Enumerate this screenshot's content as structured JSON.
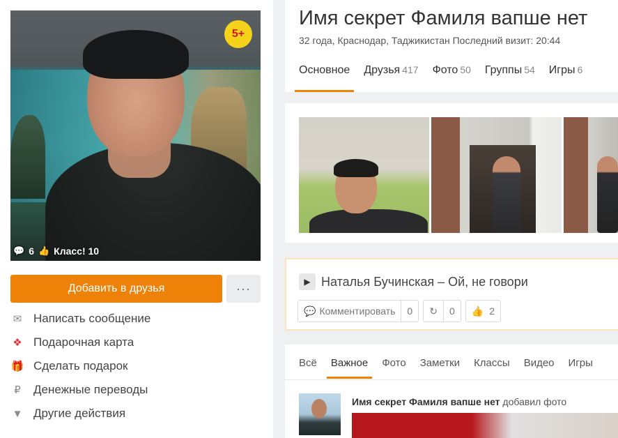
{
  "profile": {
    "badge": "5+",
    "comments_count": "6",
    "class_label": "Класс! 10",
    "add_friend_label": "Добавить в друзья",
    "more_label": "···",
    "actions": [
      {
        "icon": "envelope-icon",
        "label": "Написать сообщение"
      },
      {
        "icon": "gift-card-icon",
        "label": "Подарочная карта"
      },
      {
        "icon": "gift-icon",
        "label": "Сделать подарок"
      },
      {
        "icon": "ruble-icon",
        "label": "Денежные переводы"
      },
      {
        "icon": "chevron-down-icon",
        "label": "Другие действия"
      }
    ]
  },
  "header": {
    "name": "Имя секрет Фамиля вапше нет",
    "meta": "32 года, Краснодар, Таджикистан  Последний визит: 20:44",
    "tabs": [
      {
        "label": "Основное",
        "count": ""
      },
      {
        "label": "Друзья",
        "count": "417"
      },
      {
        "label": "Фото",
        "count": "50"
      },
      {
        "label": "Группы",
        "count": "54"
      },
      {
        "label": "Игры",
        "count": "6"
      }
    ]
  },
  "music": {
    "track": "Наталья Бучинская – Ой, не говори",
    "comment_label": "Комментировать",
    "comment_count": "0",
    "share_count": "0",
    "like_count": "2"
  },
  "feed": {
    "tabs": [
      "Всё",
      "Важное",
      "Фото",
      "Заметки",
      "Классы",
      "Видео",
      "Игры"
    ],
    "post_author": "Имя секрет Фамиля вапше нет",
    "post_action": "добавил фото"
  },
  "colors": {
    "accent": "#ee8208",
    "badge": "#f7d21a"
  }
}
